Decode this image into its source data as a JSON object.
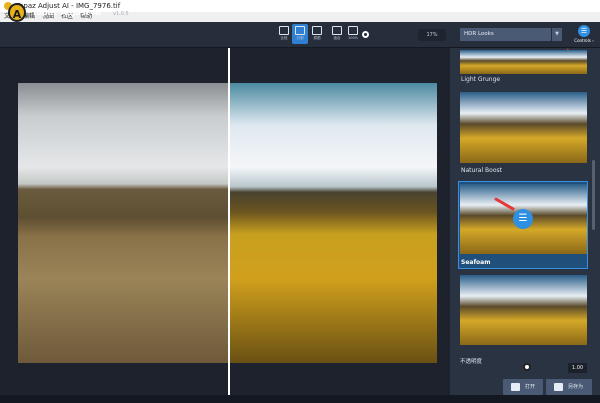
{
  "window": {
    "title": "Topaz Adjust AI - IMG_7976.tif"
  },
  "menu": [
    "文件",
    "编辑",
    "视图",
    "社区",
    "帮助"
  ],
  "app": {
    "name": "Topaz Adjust AI",
    "version": "v1.0.5"
  },
  "toolbar": {
    "buttons": [
      {
        "label": "比较",
        "icon": "compare-icon"
      },
      {
        "label": "分割",
        "icon": "split-icon",
        "active": true
      },
      {
        "label": "原图",
        "icon": "original-image-icon"
      },
      {
        "label": "适合",
        "icon": "fit-icon"
      },
      {
        "label": "100%",
        "icon": "actual-size-icon"
      }
    ],
    "zoom": "17%"
  },
  "preset_dropdown": {
    "value": "HDR Looks"
  },
  "controls": {
    "label": "Controls ›"
  },
  "presets": [
    {
      "label": "Light Grunge"
    },
    {
      "label": "Natural Boost"
    },
    {
      "label": "Seafoam",
      "selected": true
    },
    {
      "label": ""
    }
  ],
  "opacity": {
    "label": "不透明度",
    "value": "1.00",
    "level": 1.0
  },
  "buttons": {
    "open": "打开",
    "save_as": "另存为"
  },
  "colors": {
    "accent": "#2f8fe0",
    "annotation": "#e53935"
  }
}
